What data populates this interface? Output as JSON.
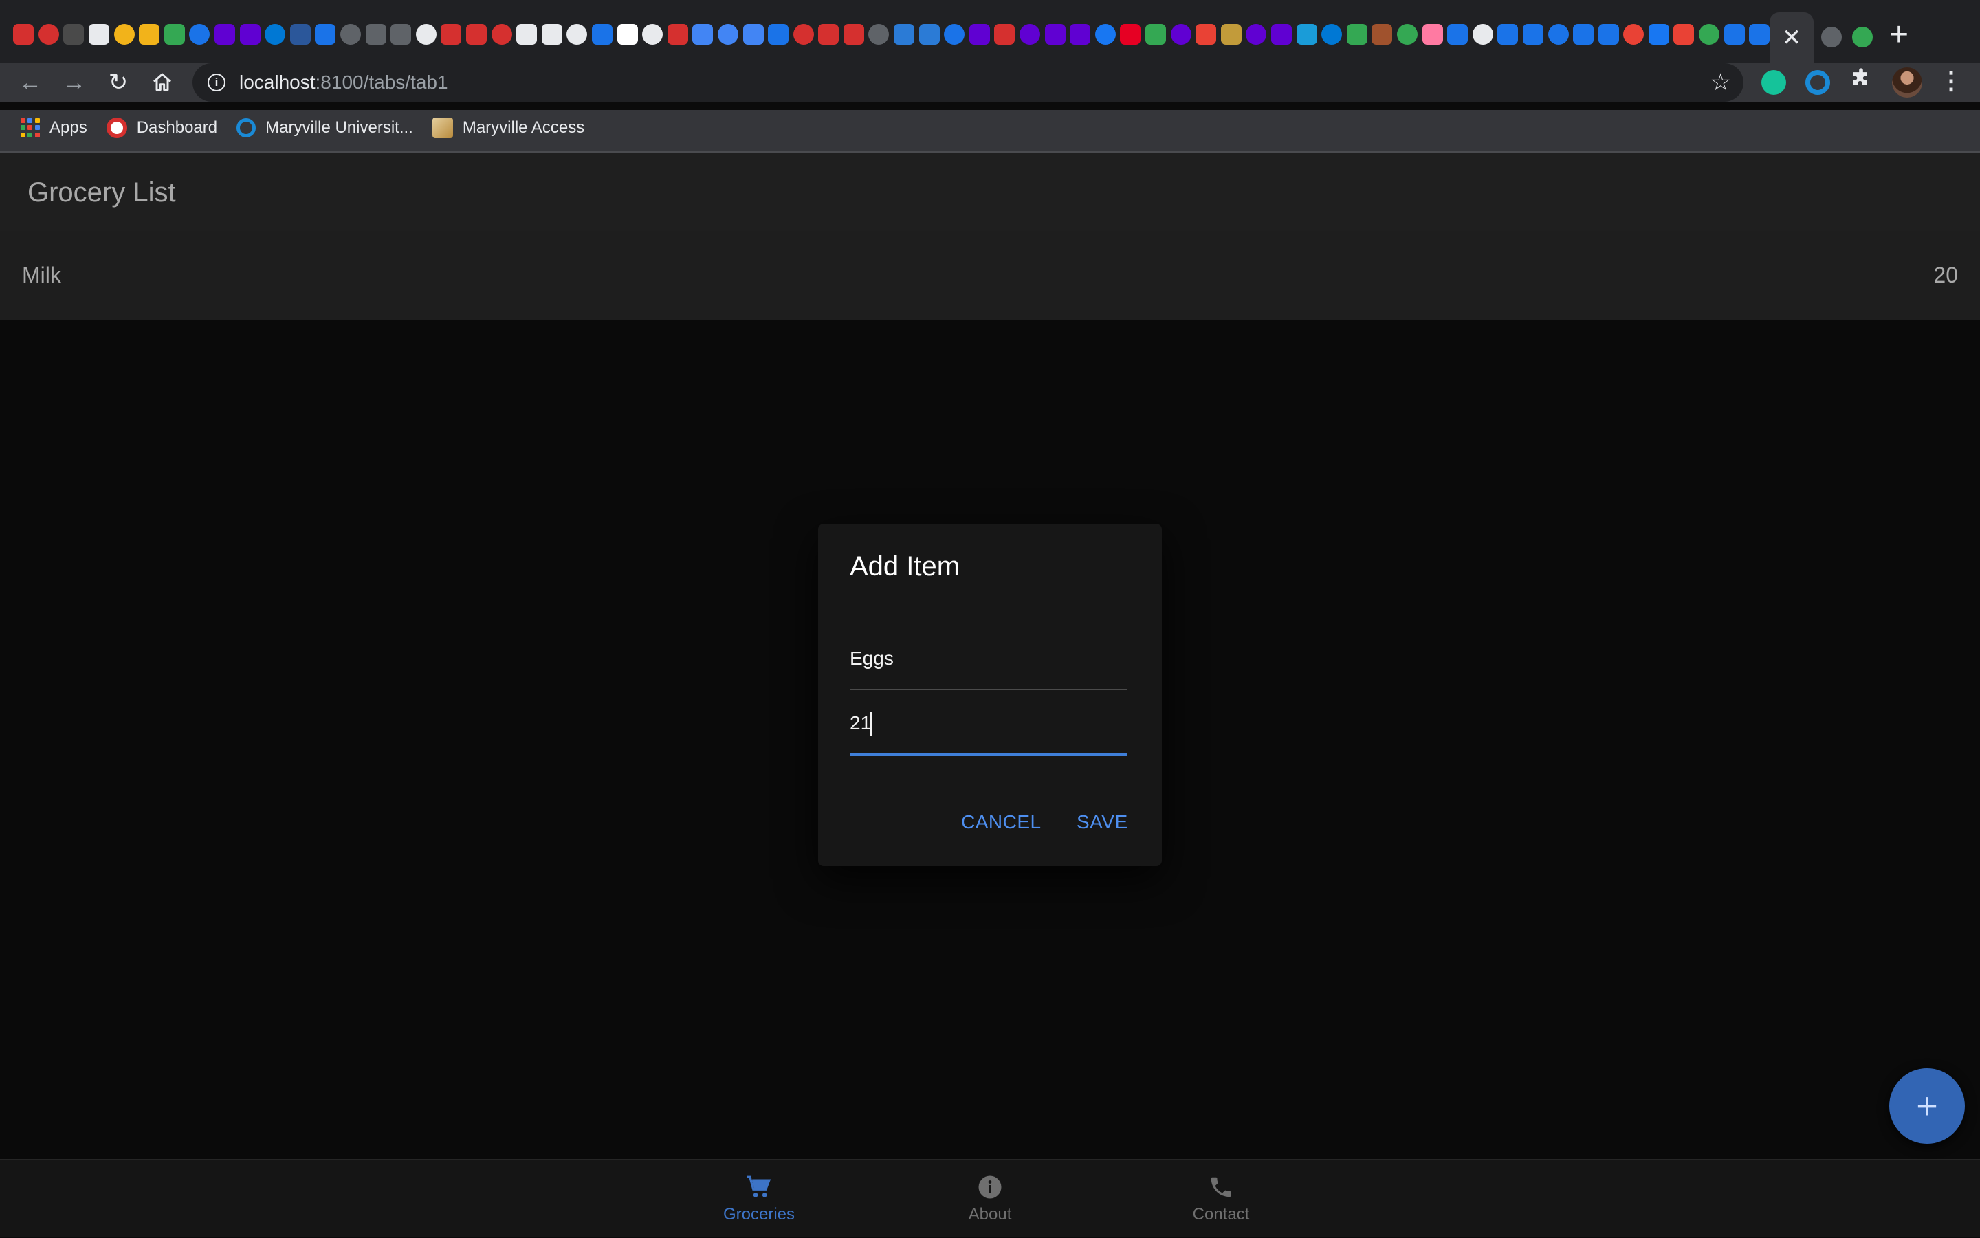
{
  "browser": {
    "url_host": "localhost",
    "url_path": ":8100/tabs/tab1",
    "favicon_colors": [
      "#d5302f",
      "#d5302f",
      "#4a4a4a",
      "#e8eaed",
      "#f2b31a",
      "#f2b31a",
      "#34a853",
      "#1a73e8",
      "#6001d2",
      "#6001d2",
      "#0078d4",
      "#2b579a",
      "#1a73e8",
      "#5f6368",
      "#5f6368",
      "#5f6368",
      "#e8eaed",
      "#d5302f",
      "#d5302f",
      "#d5302f",
      "#e8eaed",
      "#e8eaed",
      "#e8eaed",
      "#1a73e8",
      "#ffffff",
      "#e8eaed",
      "#d5302f",
      "#4285f4",
      "#4285f4",
      "#4285f4",
      "#1a73e8",
      "#d5302f",
      "#d5302f",
      "#d5302f",
      "#5f6368",
      "#2b7bd6",
      "#2b7bd6",
      "#1a73e8",
      "#6001d2",
      "#d5302f",
      "#6001d2",
      "#6001d2",
      "#6001d2",
      "#1877f2",
      "#e60023",
      "#34a853",
      "#6001d2",
      "#e94235",
      "#c29b3a",
      "#6001d2",
      "#6001d2",
      "#1a9cd8",
      "#0078d4",
      "#34a853",
      "#a0522d",
      "#34a853",
      "#ff7aa2",
      "#1a73e8",
      "#e8eaed",
      "#1a73e8",
      "#1a73e8",
      "#1a73e8",
      "#1a73e8",
      "#1a73e8",
      "#e94235",
      "#1877f2",
      "#e94235",
      "#34a853",
      "#1a73e8",
      "#1a73e8",
      "#5b5fc7",
      "#5f6368",
      "#34a853"
    ],
    "extension_colors": [
      "#15c39a",
      "#1a8ad6"
    ]
  },
  "bookmarks": [
    {
      "label": "Apps",
      "icon": "apps-grid-icon"
    },
    {
      "label": "Dashboard",
      "icon": "maryville-logo-icon"
    },
    {
      "label": "Maryville Universit...",
      "icon": "circle-logo-icon"
    },
    {
      "label": "Maryville Access",
      "icon": "image-bookmark-icon"
    }
  ],
  "app": {
    "title": "Grocery List",
    "items": [
      {
        "name": "Milk",
        "quantity": "20"
      }
    ],
    "tabs": [
      {
        "label": "Groceries",
        "icon": "cart-icon",
        "active": true
      },
      {
        "label": "About",
        "icon": "info-icon",
        "active": false
      },
      {
        "label": "Contact",
        "icon": "phone-icon",
        "active": false
      }
    ],
    "fab_icon": "add-icon"
  },
  "dialog": {
    "title": "Add Item",
    "name_value": "Eggs",
    "quantity_value": "21",
    "cancel_label": "CANCEL",
    "save_label": "SAVE"
  },
  "colors": {
    "accent": "#3f7fd9",
    "fab": "#3265b4",
    "active_tab": "#3d74c7"
  }
}
